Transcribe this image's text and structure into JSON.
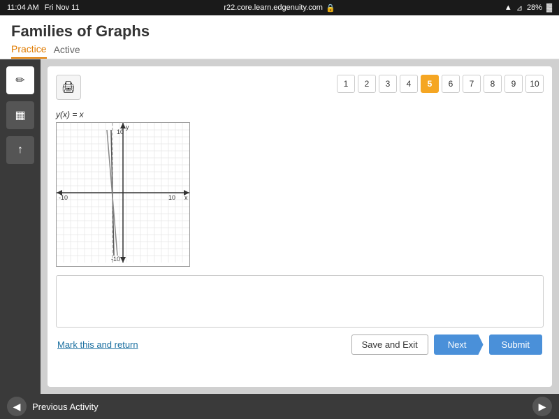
{
  "status_bar": {
    "time": "11:04 AM",
    "day_date": "Fri Nov 11",
    "url": "r22.core.learn.edgenuity.com",
    "wifi_icon": "wifi",
    "battery": "28%"
  },
  "header": {
    "title": "Families of Graphs",
    "tab_practice": "Practice",
    "tab_active": "Active"
  },
  "sidebar": {
    "btn_pencil": "✏",
    "btn_calc": "⊞",
    "btn_arrow": "↑"
  },
  "pagination": {
    "pages": [
      "1",
      "2",
      "3",
      "4",
      "5",
      "6",
      "7",
      "8",
      "9",
      "10"
    ],
    "current_page": 5
  },
  "question": {
    "function_label": "y(x) = x",
    "answer_placeholder": ""
  },
  "footer": {
    "mark_return": "Mark this and return",
    "save_exit": "Save and Exit",
    "next": "Next",
    "submit": "Submit"
  },
  "bottom_nav": {
    "prev_label": "Previous Activity"
  },
  "print_icon": "🖨"
}
